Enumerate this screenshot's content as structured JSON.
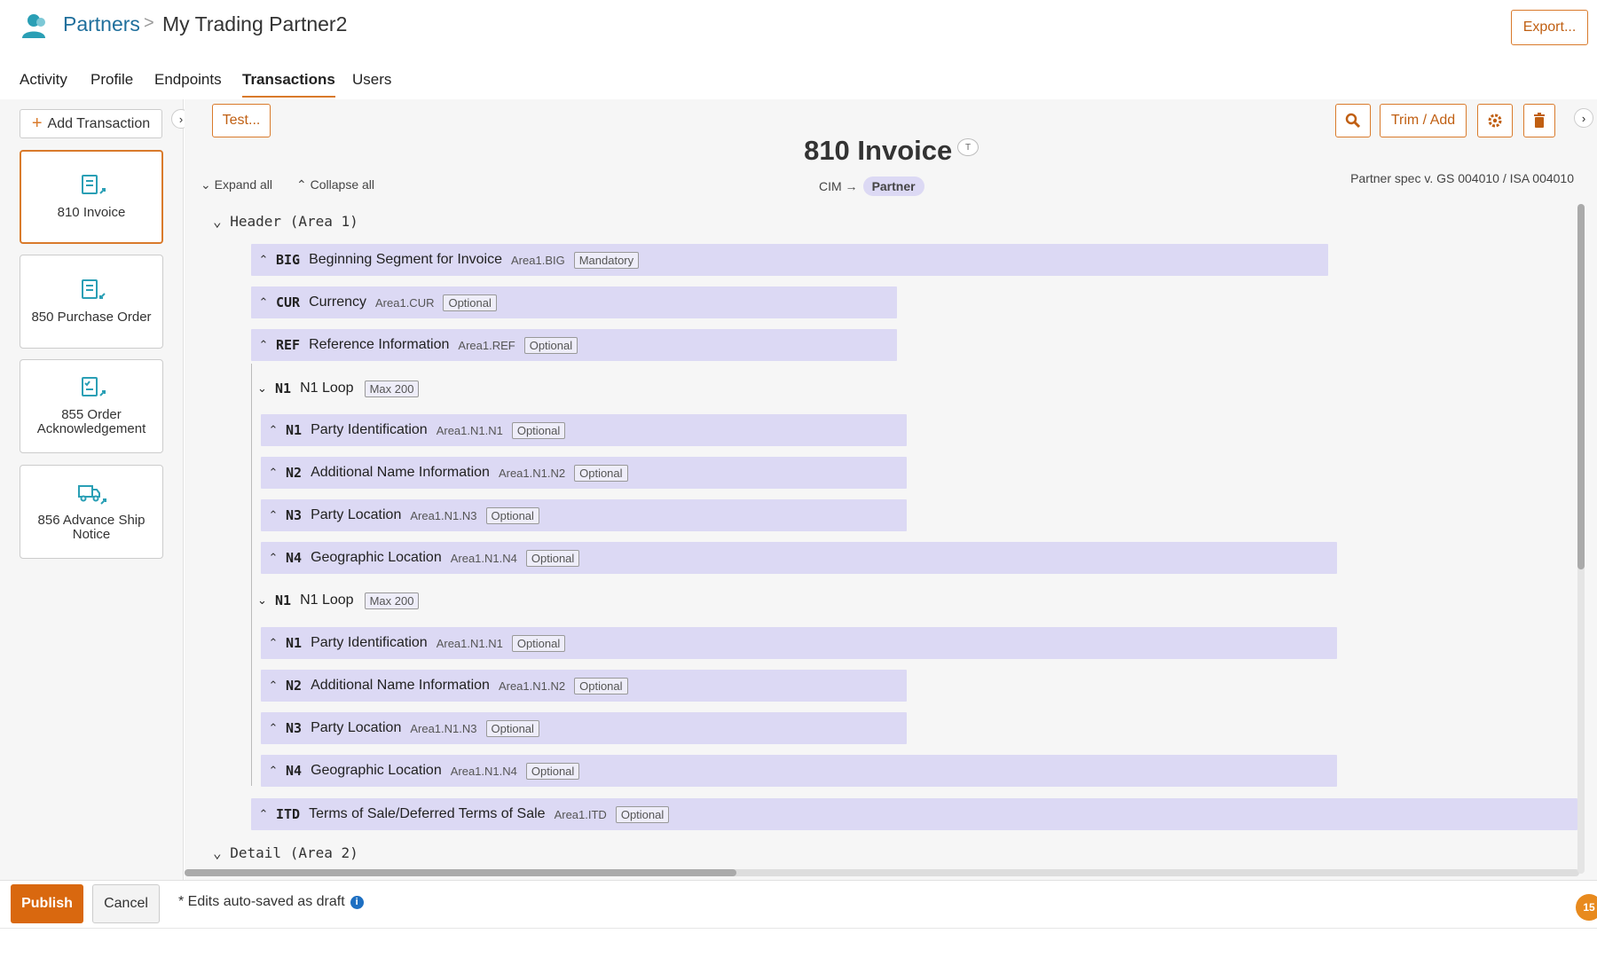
{
  "breadcrumb": {
    "root": "Partners",
    "separator": ">",
    "current": "My Trading Partner2"
  },
  "header": {
    "export_label": "Export..."
  },
  "tabs": [
    "Activity",
    "Profile",
    "Endpoints",
    "Transactions",
    "Users"
  ],
  "active_tab": "Transactions",
  "sidebar": {
    "add_label": "Add Transaction",
    "collapse_icon": "chevron-right-icon",
    "transactions": [
      {
        "label": "810 Invoice",
        "icon": "invoice-icon",
        "active": true
      },
      {
        "label": "850 Purchase Order",
        "icon": "purchase-order-icon",
        "active": false
      },
      {
        "label": "855 Order Acknowledgement",
        "icon": "acknowledgement-icon",
        "active": false
      },
      {
        "label": "856 Advance Ship Notice",
        "icon": "truck-icon",
        "active": false
      }
    ]
  },
  "toolbar": {
    "test_label": "Test...",
    "trim_add_label": "Trim / Add",
    "search_icon": "search-icon",
    "settings_icon": "gear-icon",
    "delete_icon": "trash-icon"
  },
  "transaction": {
    "title": "810 Invoice *",
    "badge": "T",
    "mapping_from": "CIM →",
    "mapping_to": "Partner",
    "partner_spec": "Partner spec v. GS 004010 / ISA 004010",
    "expand_all": "Expand all",
    "collapse_all": "Collapse all"
  },
  "areas": {
    "header": "Header (Area 1)",
    "detail": "Detail (Area 2)"
  },
  "segments": [
    {
      "code": "BIG",
      "name": "Beginning Segment for Invoice",
      "path": "Area1.BIG",
      "tag": "Mandatory"
    },
    {
      "code": "CUR",
      "name": "Currency",
      "path": "Area1.CUR",
      "tag": "Optional"
    },
    {
      "code": "REF",
      "name": "Reference Information",
      "path": "Area1.REF",
      "tag": "Optional"
    },
    {
      "code": "N1",
      "name": "Party Identification",
      "path": "Area1.N1.N1",
      "tag": "Optional"
    },
    {
      "code": "N2",
      "name": "Additional Name Information",
      "path": "Area1.N1.N2",
      "tag": "Optional"
    },
    {
      "code": "N3",
      "name": "Party Location",
      "path": "Area1.N1.N3",
      "tag": "Optional"
    },
    {
      "code": "N4",
      "name": "Geographic Location",
      "path": "Area1.N1.N4",
      "tag": "Optional"
    },
    {
      "code": "N1",
      "name": "Party Identification",
      "path": "Area1.N1.N1",
      "tag": "Optional"
    },
    {
      "code": "N2",
      "name": "Additional Name Information",
      "path": "Area1.N1.N2",
      "tag": "Optional"
    },
    {
      "code": "N3",
      "name": "Party Location",
      "path": "Area1.N1.N3",
      "tag": "Optional"
    },
    {
      "code": "N4",
      "name": "Geographic Location",
      "path": "Area1.N1.N4",
      "tag": "Optional"
    },
    {
      "code": "ITD",
      "name": "Terms of Sale/Deferred Terms of Sale",
      "path": "Area1.ITD",
      "tag": "Optional"
    }
  ],
  "loops": [
    {
      "code": "N1",
      "name": "N1 Loop",
      "tag": "Max 200"
    },
    {
      "code": "N1",
      "name": "N1 Loop",
      "tag": "Max 200"
    }
  ],
  "footer": {
    "publish_label": "Publish",
    "cancel_label": "Cancel",
    "autosave_text": "* Edits auto-saved as draft",
    "notification_count": "15"
  },
  "colors": {
    "accent": "#d9680f",
    "segment_bg": "#dcd9f4",
    "link": "#1f6f9c"
  }
}
